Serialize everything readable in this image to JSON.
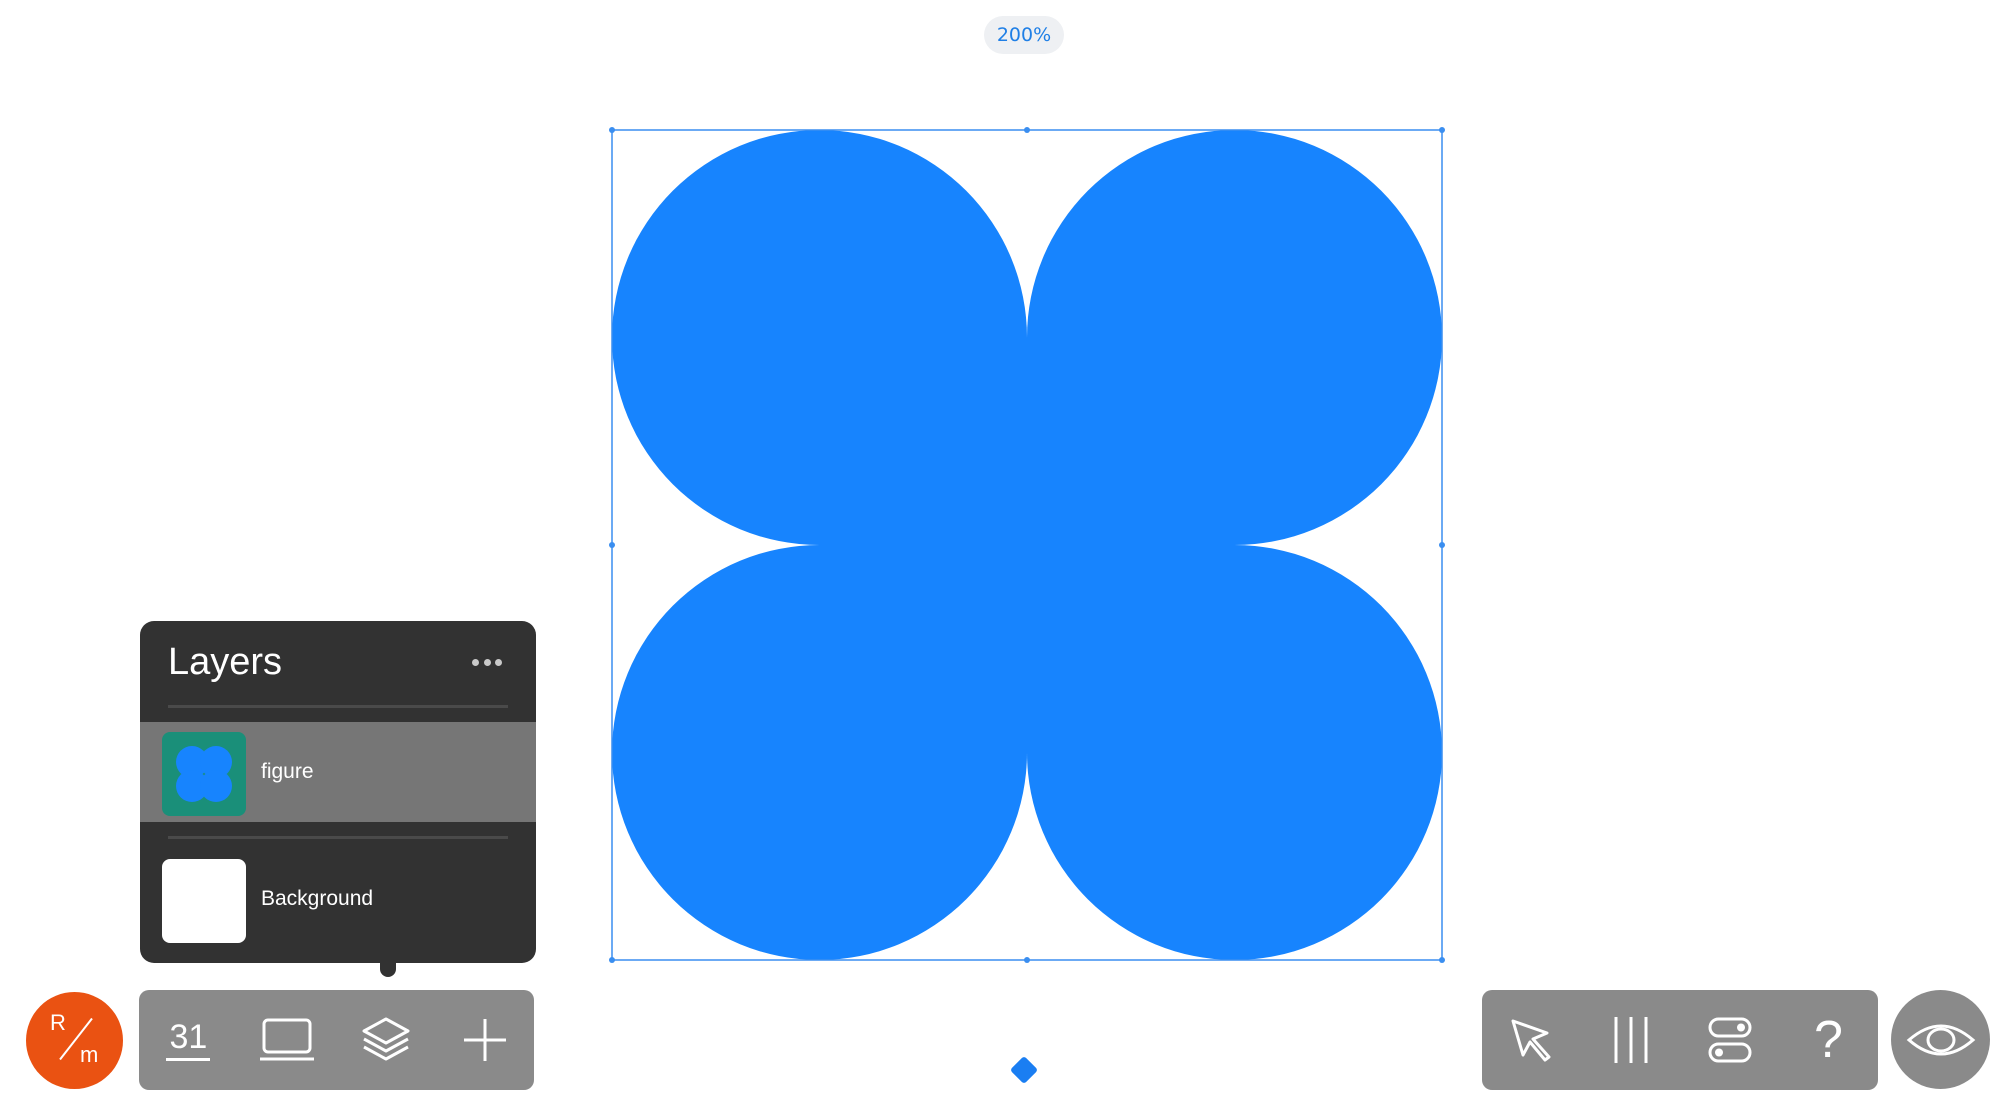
{
  "zoom": {
    "label": "200%"
  },
  "canvas": {
    "shape_color": "#1784fe",
    "selection_color": "#3a8ef0"
  },
  "layers_panel": {
    "title": "Layers",
    "more_icon": "ellipsis-icon",
    "layers": [
      {
        "name": "figure",
        "selected": true,
        "thumb": "figure-thumbnail",
        "thumb_bg": "#1a8f79"
      },
      {
        "name": "Background",
        "selected": false,
        "thumb": "blank-thumbnail",
        "thumb_bg": "#ffffff"
      }
    ]
  },
  "app_logo": {
    "top": "R",
    "bottom": "m",
    "color": "#ea5212"
  },
  "toolbar_left": {
    "calendar_label": "31",
    "items": [
      "calendar-icon",
      "artboard-icon",
      "layers-icon",
      "add-icon"
    ]
  },
  "toolbar_right": {
    "items": [
      "select-arrow-icon",
      "columns-icon",
      "toggles-icon",
      "help-icon"
    ],
    "help_label": "?"
  },
  "preview": {
    "icon": "eye-icon"
  },
  "colors": {
    "toolbar": "#8a8a8a",
    "panel": "#323232",
    "selected_row": "#767676",
    "accent": "#1784fe"
  }
}
